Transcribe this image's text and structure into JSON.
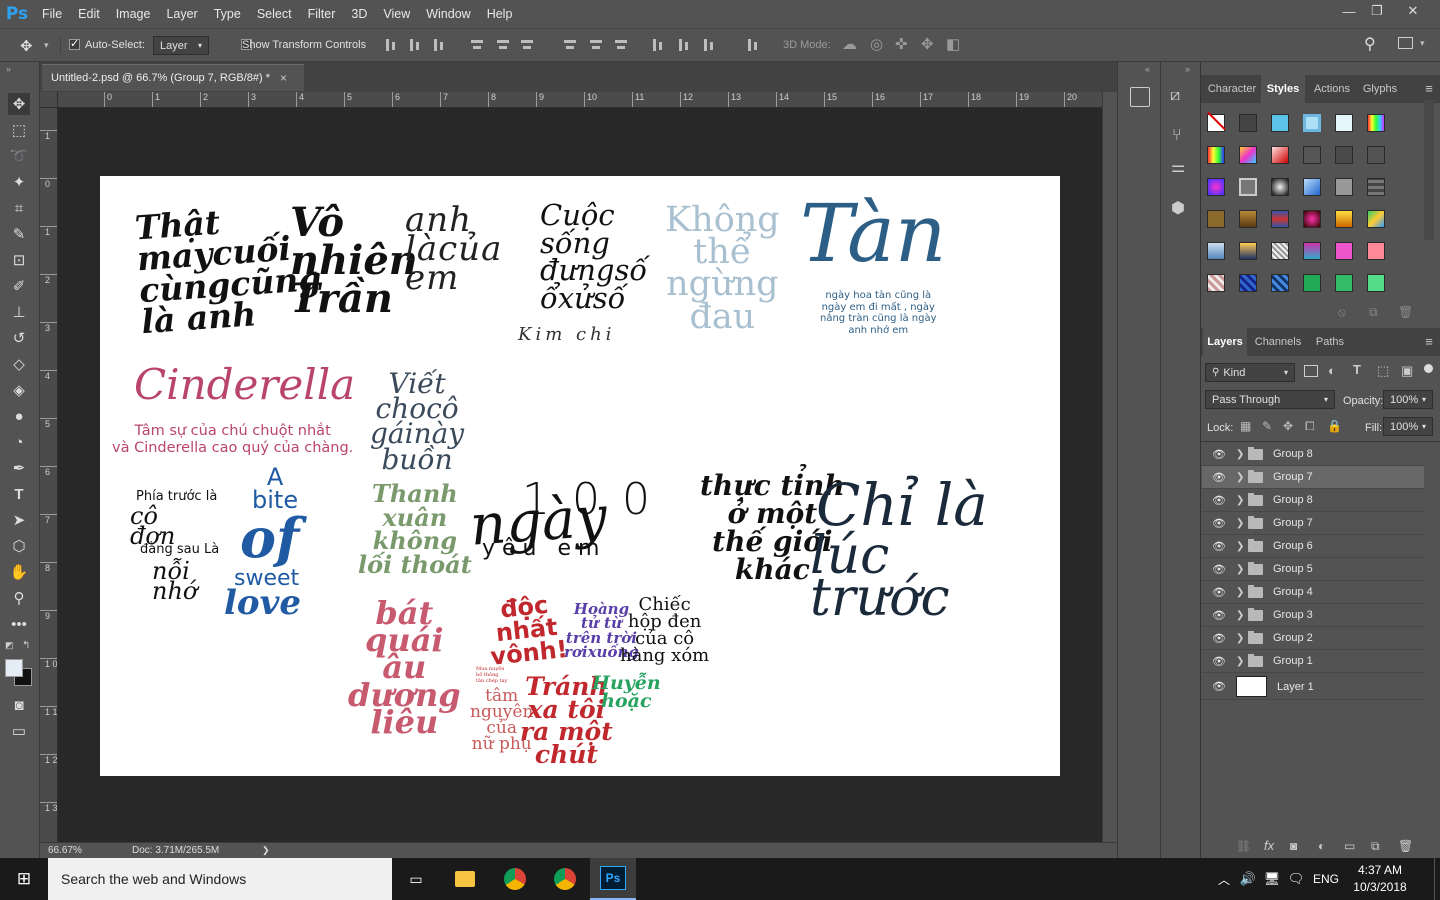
{
  "app": {
    "logo": "Ps"
  },
  "menu": [
    "File",
    "Edit",
    "Image",
    "Layer",
    "Type",
    "Select",
    "Filter",
    "3D",
    "View",
    "Window",
    "Help"
  ],
  "window_controls": {
    "minimize": "—",
    "restore": "❐",
    "close": "✕"
  },
  "options_bar": {
    "auto_select_label": "Auto-Select:",
    "auto_select_checked": true,
    "auto_select_target": "Layer",
    "show_transform_label": "Show Transform Controls",
    "show_transform_checked": false,
    "mode_3d_label": "3D Mode:"
  },
  "document": {
    "tab_title": "Untitled-2.psd @ 66.7% (Group 7, RGB/8#) *",
    "close_glyph": "×",
    "zoom": "66.67%",
    "doc_info": "Doc: 3.71M/265.5M",
    "status_arrow": "❯"
  },
  "rulers": {
    "top": [
      "0",
      "1",
      "2",
      "3",
      "4",
      "5",
      "6",
      "7",
      "8",
      "9",
      "10",
      "11",
      "12",
      "13",
      "14",
      "15",
      "16",
      "17",
      "18",
      "19",
      "20"
    ],
    "left": [
      "1",
      "0",
      "1",
      "2",
      "3",
      "4",
      "5",
      "6",
      "7",
      "8",
      "9",
      "1 0",
      "1 1",
      "1 2",
      "1 3"
    ]
  },
  "artwork": {
    "that_may": "Thật\nmaycuối\ncùngcũng\nlà anh",
    "vo_nhien": "Vô\nnhiên\nTrần",
    "anh_la": "anh\nlàcủa\nem",
    "cuoc_song": "Cuộc\nsống\nđưngsố\nổxửsố",
    "kim_chi": "Kim chi",
    "khong_the": "Không\nthể\nngừng\nđau",
    "tan": "Tàn",
    "tan_sub": "ngày hoa tàn cũng là\nngày em đi mất , ngày\nnắng tràn cũng là ngày\nanh nhớ em",
    "cinderella": "Cinderella",
    "cinderella_sub": "Tâm sự của chú chuột nhắt\nvà Cinderella cao quý của chàng.",
    "viet_cho": "Viết\nchocô\ngáinày\nbuồn",
    "phia_truoc": "Phía trước là",
    "co_don": "cô\nđơn",
    "dang_sau": "đằng sau Là",
    "noi_nho": "nỗi\nnhớ",
    "a_bite": "A\nbite",
    "of": "of",
    "sweet": "sweet",
    "love": "love",
    "thanh_xuan": "Thanh\nxuân\nkhông\nlối thoát",
    "100": "1 0 0",
    "ngay": "ngày",
    "yeu_em": "y ê u   e m",
    "thuc_tinh": "thực tỉnh\nở một\nthế giới\nkhác",
    "chi_la": "Chỉ là",
    "luc_truoc": "lúc\ntrước",
    "bat_quai": "bát\nquái\nâu\ndương\nliêu",
    "doc_nhat": "độc\nnhất\nvônh!",
    "small_print": "Mua nuyền\nbố thông\ntân chép tay",
    "tam_nguyen": "tâm\nnguyên\ncủa\nnữ phụ",
    "hoang_tu": "Hoàng\ntử từ\ntrên trời\nrơixuống",
    "chiec_hop": "Chiếc\nhộp đen\ncủa cô\nhàng xóm",
    "tranh_xa": "Tránh\nxa tôi\nra một\nchút",
    "huyen_hoac": "Huyễn\nhoặc",
    "colors": {
      "black": "#111111",
      "blue_tan": "#2d5f86",
      "pale_blue": "#a9c0d0",
      "pink": "#b9456f",
      "navy": "#1f5aa3",
      "green": "#7a9a6d",
      "red": "#c0282d",
      "purple": "#5a3ea8",
      "teal_green": "#27a35f",
      "rose": "#c85a70"
    }
  },
  "panels": {
    "top_tabs": [
      "Character",
      "Styles",
      "Actions",
      "Glyphs"
    ],
    "top_active": "Styles",
    "layers_tabs": [
      "Layers",
      "Channels",
      "Paths"
    ],
    "layers_active": "Layers",
    "filter_kind": "Kind",
    "blend_mode": "Pass Through",
    "opacity_label": "Opacity:",
    "opacity_value": "100%",
    "lock_label": "Lock:",
    "fill_label": "Fill:",
    "fill_value": "100%",
    "layers": [
      {
        "name": "Group 8",
        "type": "group",
        "selected": false
      },
      {
        "name": "Group 7",
        "type": "group",
        "selected": true
      },
      {
        "name": "Group 8",
        "type": "group",
        "selected": false
      },
      {
        "name": "Group 7",
        "type": "group",
        "selected": false
      },
      {
        "name": "Group 6",
        "type": "group",
        "selected": false
      },
      {
        "name": "Group 5",
        "type": "group",
        "selected": false
      },
      {
        "name": "Group 4",
        "type": "group",
        "selected": false
      },
      {
        "name": "Group 3",
        "type": "group",
        "selected": false
      },
      {
        "name": "Group 2",
        "type": "group",
        "selected": false
      },
      {
        "name": "Group 1",
        "type": "group",
        "selected": false
      },
      {
        "name": "Layer 1",
        "type": "layer",
        "selected": false
      }
    ]
  },
  "taskbar": {
    "search_placeholder": "Search the web and Windows",
    "lang": "ENG",
    "time": "4:37 AM",
    "date": "10/3/2018",
    "ps_label": "Ps"
  }
}
